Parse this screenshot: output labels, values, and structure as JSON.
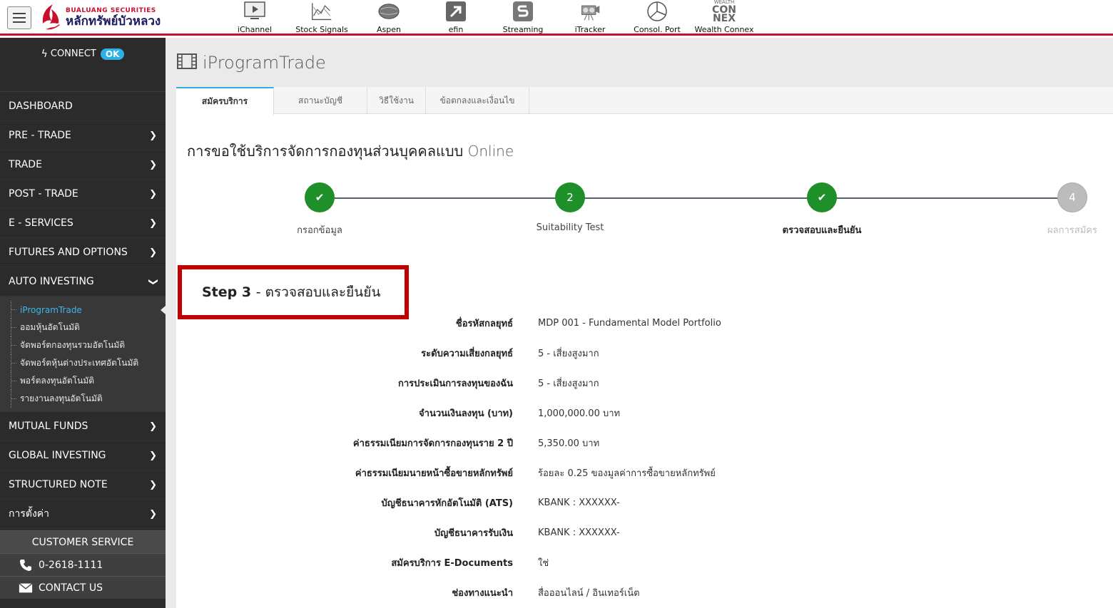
{
  "brand": {
    "en": "BUALUANG SECURITIES",
    "th": "หลักทรัพย์บัวหลวง"
  },
  "toolbar": [
    {
      "label": "iChannel",
      "icon": "play-screen-icon"
    },
    {
      "label": "Stock Signals",
      "icon": "signal-chart-icon"
    },
    {
      "label": "Aspen",
      "icon": "globe-icon"
    },
    {
      "label": "efin",
      "icon": "efin-arrow-icon"
    },
    {
      "label": "Streaming",
      "icon": "streaming-s-icon"
    },
    {
      "label": "iTracker",
      "icon": "tracker-icon"
    },
    {
      "label": "Consol. Port",
      "icon": "pie-chart-icon"
    },
    {
      "label": "Wealth Connex",
      "icon": "wealth-connex-logo",
      "logo_top": "WEALTH",
      "logo_mid1": "CON",
      "logo_mid2": "NEX"
    }
  ],
  "sidebar": {
    "connect_label": "CONNECT",
    "connect_status": "OK",
    "items": [
      {
        "label": "DASHBOARD",
        "chevron": false
      },
      {
        "label": "PRE - TRADE",
        "chevron": true
      },
      {
        "label": "TRADE",
        "chevron": true
      },
      {
        "label": "POST - TRADE",
        "chevron": true
      },
      {
        "label": "E - SERVICES",
        "chevron": true
      },
      {
        "label": "FUTURES AND OPTIONS",
        "chevron": true
      },
      {
        "label": "AUTO INVESTING",
        "chevron": true,
        "expanded": true
      }
    ],
    "subitems": [
      "iProgramTrade",
      "ออมหุ้นอัตโนมัติ",
      "จัดพอร์ตกองทุนรวมอัตโนมัติ",
      "จัดพอร์ตหุ้นต่างประเทศอัตโนมัติ",
      "พอร์ตลงทุนอัตโนมัติ",
      "รายงานลงทุนอัตโนมัติ"
    ],
    "items_after": [
      {
        "label": "MUTUAL FUNDS"
      },
      {
        "label": "GLOBAL INVESTING"
      },
      {
        "label": "STRUCTURED NOTE"
      },
      {
        "label": "การตั้งค่า"
      }
    ],
    "customer_service": "CUSTOMER SERVICE",
    "phone": "0-2618-1111",
    "contact": "CONTACT US"
  },
  "page": {
    "title": "iProgramTrade",
    "tabs": [
      "สมัครบริการ",
      "สถานะบัญชี",
      "วิธีใช้งาน",
      "ข้อตกลงและเงื่อนไข"
    ],
    "form_title_th": "การขอใช้บริการจัดการกองทุนส่วนบุคคลแบบ",
    "form_title_en": "Online",
    "steps": [
      {
        "label": "กรอกข้อมูล",
        "state": "done",
        "mark": "✔"
      },
      {
        "label": "Suitability Test",
        "state": "current",
        "mark": "2"
      },
      {
        "label": "ตรวจสอบและยืนยัน",
        "state": "done",
        "mark": "✔"
      },
      {
        "label": "ผลการสมัคร",
        "state": "pending",
        "mark": "4"
      }
    ],
    "step_heading": "Step 3",
    "step_heading_sub": "- ตรวจสอบและยืนยัน",
    "rows": [
      {
        "k": "ชื่อรหัสกลยุทธ์",
        "v": "MDP 001 - Fundamental Model Portfolio"
      },
      {
        "k": "ระดับความเสี่ยงกลยุทธ์",
        "v": "5 - เสี่ยงสูงมาก"
      },
      {
        "k": "การประเมินการลงทุนของฉัน",
        "v": "5 - เสี่ยงสูงมาก"
      },
      {
        "k": "จำนวนเงินลงทุน (บาท)",
        "v": "1,000,000.00 บาท"
      },
      {
        "k": "ค่าธรรมเนียมการจัดการกองทุนราย 2 ปี",
        "v": "5,350.00 บาท"
      },
      {
        "k": "ค่าธรรมเนียมนายหน้าซื้อขายหลักทรัพย์",
        "v": "ร้อยละ 0.25 ของมูลค่าการซื้อขายหลักทรัพย์"
      },
      {
        "k": "บัญชีธนาคารหักอัตโนมัติ (ATS)",
        "v": "KBANK : XXXXXX-"
      },
      {
        "k": "บัญชีธนาคารรับเงิน",
        "v": "KBANK : XXXXXX-"
      },
      {
        "k": "สมัครบริการ E-Documents",
        "v": "ใช่"
      },
      {
        "k": "ช่องทางแนะนำ",
        "v": "สื่อออนไลน์ / อินเทอร์เน็ต"
      }
    ]
  },
  "colors": {
    "brand_red": "#c8102e",
    "accent_blue": "#2db0e8",
    "step_green": "#1f8f2a",
    "highlight_red": "#c00000"
  }
}
